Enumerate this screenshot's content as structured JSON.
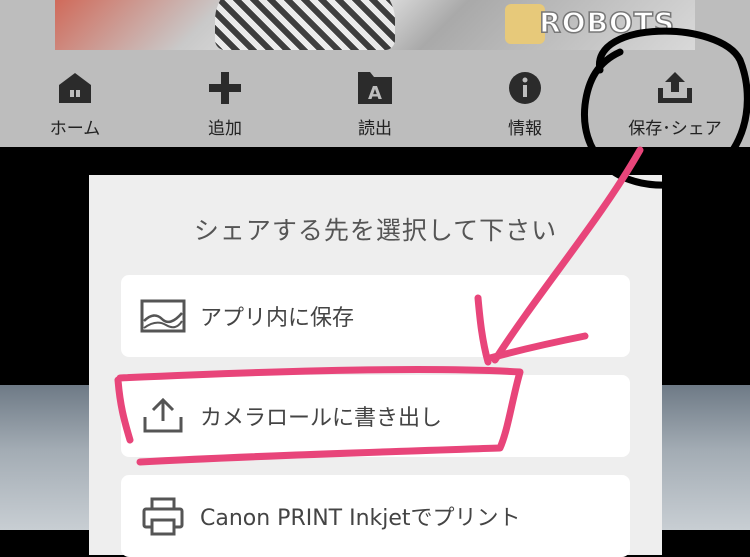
{
  "banner": {
    "logo_text": "ROBOTS"
  },
  "toolbar": {
    "items": [
      {
        "label": "ホーム",
        "icon": "home-icon"
      },
      {
        "label": "追加",
        "icon": "plus-icon"
      },
      {
        "label": "読出",
        "icon": "document-a-icon"
      },
      {
        "label": "情報",
        "icon": "info-icon"
      },
      {
        "label": "保存･シェア",
        "icon": "upload-icon"
      }
    ]
  },
  "dialog": {
    "title": "シェアする先を選択して下さい",
    "options": [
      {
        "label": "アプリ内に保存",
        "icon": "image-icon"
      },
      {
        "label": "カメラロールに書き出し",
        "icon": "upload-icon"
      },
      {
        "label": "Canon PRINT Inkjetでプリント",
        "icon": "printer-icon"
      }
    ]
  },
  "annotation_color": "#e8457a"
}
